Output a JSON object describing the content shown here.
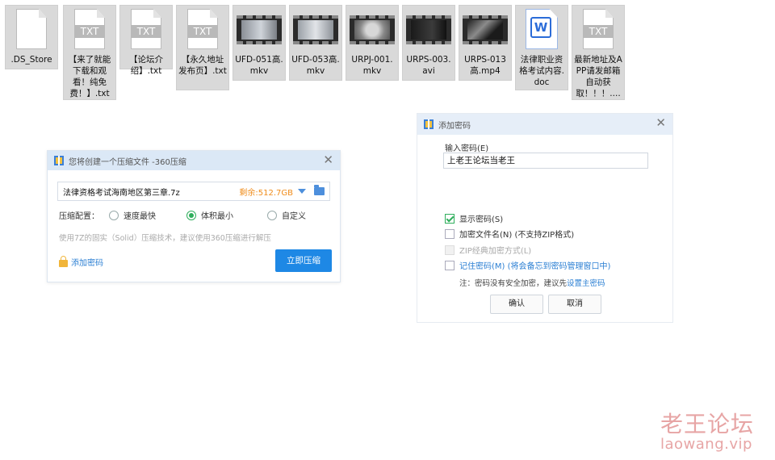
{
  "files": [
    {
      "kind": "blank",
      "name": ".DS_Store"
    },
    {
      "kind": "txt",
      "badge": "TXT",
      "name": "【来了就能下载和观看！纯免费！】.txt"
    },
    {
      "kind": "txt",
      "badge": "TXT",
      "name": "【论坛介绍】.txt"
    },
    {
      "kind": "txt",
      "badge": "TXT",
      "name": "【永久地址发布页】.txt"
    },
    {
      "kind": "video",
      "name": "UFD-051高.mkv"
    },
    {
      "kind": "video",
      "name": "UFD-053高.mkv"
    },
    {
      "kind": "video",
      "name": "URPJ-001.mkv"
    },
    {
      "kind": "video",
      "name": "URPS-003.avi"
    },
    {
      "kind": "video",
      "name": "URPS-013高.mp4"
    },
    {
      "kind": "word",
      "badge": "W",
      "name": "法律职业资格考试内容.doc"
    },
    {
      "kind": "txt",
      "badge": "TXT",
      "name": "最新地址及APP请发邮箱自动获取！！！...."
    }
  ],
  "compress_dialog": {
    "title": "您将创建一个压缩文件 -360压缩",
    "filename": "法律资格考试海南地区第三章.7z",
    "space": "剩余:512.7GB",
    "config_label": "压缩配置：",
    "options": [
      "速度最快",
      "体积最小",
      "自定义"
    ],
    "selected": "体积最小",
    "hint": "使用7Z的固实（Solid）压缩技术，建议使用360压缩进行解压",
    "add_password": "添加密码",
    "start_button": "立即压缩"
  },
  "password_dialog": {
    "title": "添加密码",
    "input_label": "输入密码(E)",
    "password_value": "上老王论坛当老王",
    "show_password": "显示密码(S)",
    "show_password_checked": true,
    "encrypt_names": "加密文件名(N) (不支持ZIP格式)",
    "zip_classic": "ZIP经典加密方式(L)",
    "remember": "记住密码(M) (将会备忘到密码管理窗口中)",
    "note_prefix": "注：密码没有安全加密，建议先",
    "note_link": "设置主密码",
    "ok": "确认",
    "cancel": "取消"
  },
  "watermark": {
    "line1": "老王论坛",
    "line2": "laowang.vip"
  },
  "colors": {
    "accent": "#1e88e5",
    "radio_on": "#2fae5c",
    "space_text": "#f08c1a",
    "watermark": "#e7a5a5"
  }
}
